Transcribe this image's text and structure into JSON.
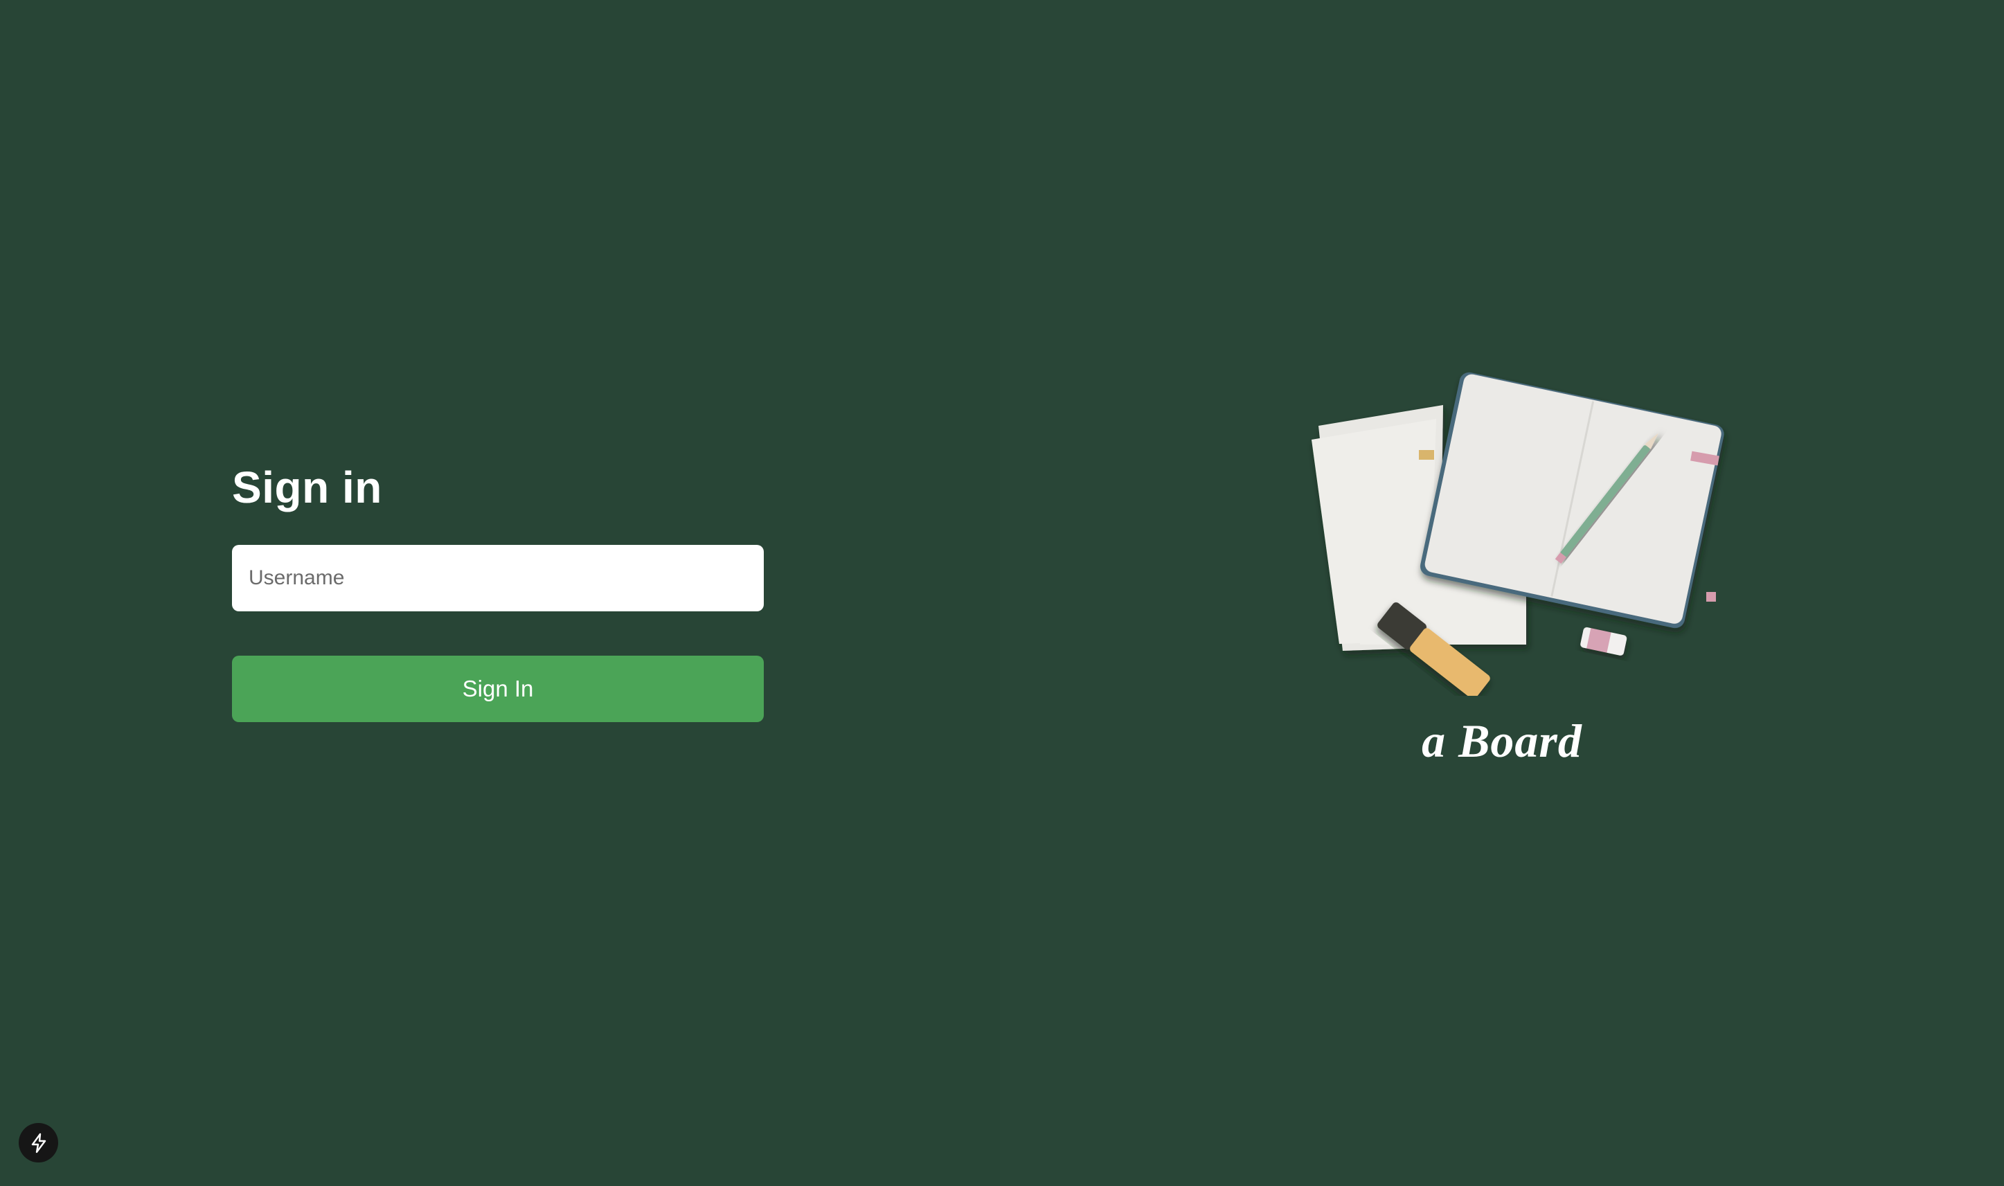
{
  "signin": {
    "title": "Sign in",
    "username_placeholder": "Username",
    "username_value": "",
    "button_label": "Sign In"
  },
  "brand": {
    "name": "a Board"
  },
  "dev_indicator": {
    "icon": "lightning-bolt-icon"
  },
  "colors": {
    "background": "#284536",
    "primary_button": "#4ba457",
    "text": "#ffffff"
  }
}
